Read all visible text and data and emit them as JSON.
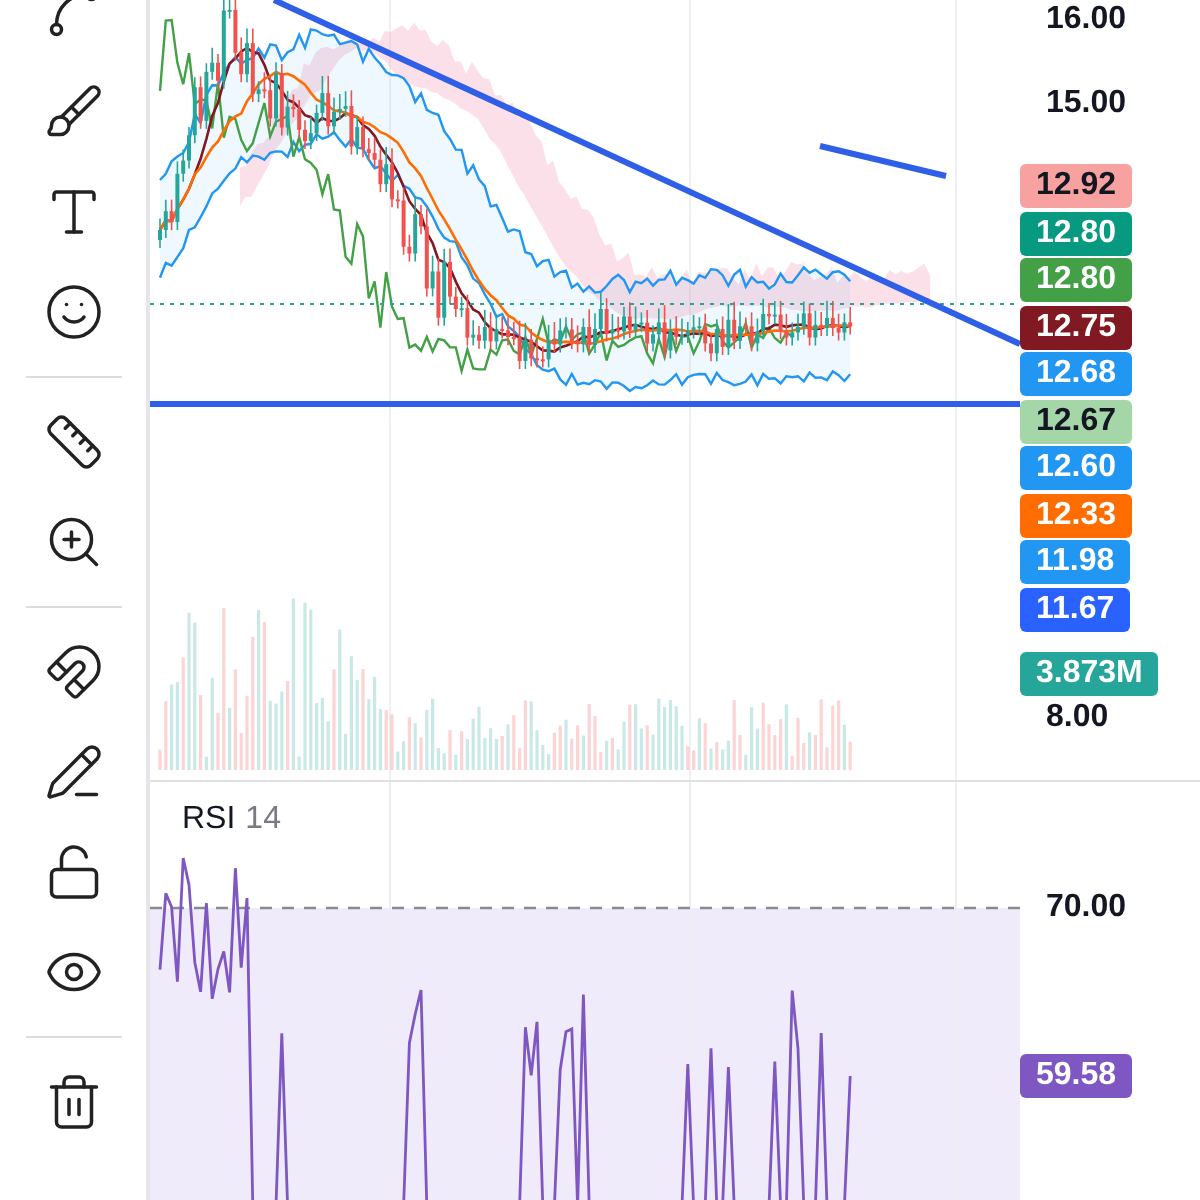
{
  "toolbar": {
    "groups": [
      [
        {
          "kind": "trend"
        },
        {
          "kind": "brush"
        },
        {
          "kind": "text"
        },
        {
          "kind": "emoji"
        }
      ],
      [
        {
          "kind": "ruler"
        },
        {
          "kind": "zoom"
        }
      ],
      [
        {
          "kind": "magnet"
        },
        {
          "kind": "lock-drawing"
        },
        {
          "kind": "lock"
        },
        {
          "kind": "eye"
        }
      ],
      [
        {
          "kind": "trash"
        }
      ]
    ]
  },
  "price_pane": {
    "axis_ticks": [
      "16.00",
      "15.00"
    ],
    "labels": [
      {
        "text": "12.92",
        "color": "#f7a1a1"
      },
      {
        "text": "12.80",
        "color": "#089981"
      },
      {
        "text": "12.80",
        "color": "#43a047"
      },
      {
        "text": "12.75",
        "color": "#801922"
      },
      {
        "text": "12.68",
        "color": "#2196f3"
      },
      {
        "text": "12.67",
        "color": "#a5d6a7"
      },
      {
        "text": "12.60",
        "color": "#2196f3"
      },
      {
        "text": "12.33",
        "color": "#ff6d00"
      },
      {
        "text": "11.98",
        "color": "#2196f3"
      },
      {
        "text": "11.67",
        "color": "#2962ff"
      }
    ],
    "volume_label": {
      "text": "3.873M",
      "color": "#26a69a"
    },
    "bottom_tick": "8.00"
  },
  "rsi_pane": {
    "title": "RSI",
    "length": "14",
    "level_tick": "70.00",
    "value": "59.58"
  }
}
